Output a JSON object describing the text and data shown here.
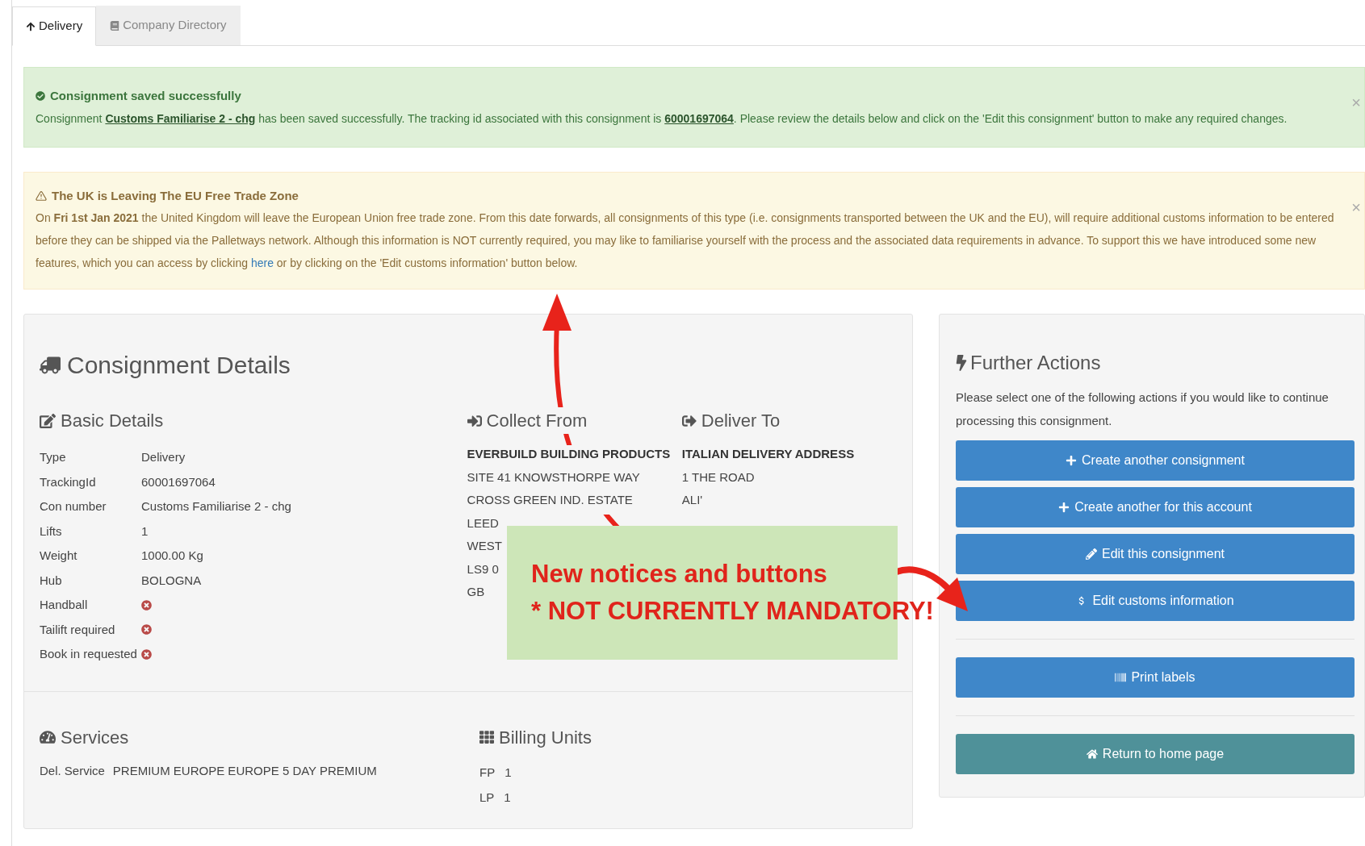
{
  "tabs": [
    {
      "label": "Delivery",
      "selected": true
    },
    {
      "label": "Company Directory",
      "selected": false
    }
  ],
  "success_alert": {
    "title": "Consignment saved successfully",
    "close": "×",
    "parts": [
      {
        "kind": "text",
        "text": "Consignment "
      },
      {
        "kind": "link",
        "text": "Customs Familiarise 2 - chg"
      },
      {
        "kind": "text",
        "text": " has been saved successfully. The tracking id associated with this consignment is "
      },
      {
        "kind": "link",
        "text": "60001697064"
      },
      {
        "kind": "text",
        "text": ". Please review the details below and click on the 'Edit this consignment' button to make any required changes."
      }
    ]
  },
  "warning_alert": {
    "title": "The UK is Leaving The EU Free Trade Zone",
    "close": "×",
    "parts": [
      {
        "kind": "text",
        "text": "On **Fri 1st Jan 2021** the United Kingdom will leave the European Union free trade zone. From this date forwards, all consignments of this type (i.e. consignments transported between the UK and the EU), will require additional customs information to be entered before they can be shipped via the Palletways network. Although this information is NOT currently required, you may like to familiarise yourself with the process and the associated data requirements in advance. To support this we have introduced some new features, which you can access by clicking "
      },
      {
        "kind": "link",
        "text": "here"
      },
      {
        "kind": "text",
        "text": " or by clicking on the 'Edit customs information' button below."
      }
    ]
  },
  "consignment": {
    "title": "Consignment Details",
    "basic_title": "Basic Details",
    "rows": [
      {
        "label": "Type",
        "kind": "text",
        "value": "Delivery"
      },
      {
        "label": "TrackingId",
        "kind": "text",
        "value": "60001697064"
      },
      {
        "label": "Con number",
        "kind": "text",
        "value": "Customs Familiarise 2 - chg"
      },
      {
        "label": "Lifts",
        "kind": "text",
        "value": "1"
      },
      {
        "label": "Weight",
        "kind": "text",
        "value": "1000.00 Kg"
      },
      {
        "label": "Hub",
        "kind": "text",
        "value": "BOLOGNA"
      },
      {
        "label": "Handball",
        "kind": "flag",
        "on": false
      },
      {
        "label": "Tailift required",
        "kind": "flag",
        "on": false
      },
      {
        "label": "Book in requested",
        "kind": "flag",
        "on": false
      }
    ],
    "addresses": [
      {
        "title": "Collect From",
        "name": "EVERBUILD BUILDING PRODUCTS",
        "lines": [
          "SITE 41 KNOWSTHORPE WAY",
          "CROSS GREEN IND. ESTATE",
          "LEED",
          "WEST",
          "LS9 0",
          "GB"
        ]
      },
      {
        "title": "Deliver To",
        "name": "ITALIAN DELIVERY ADDRESS",
        "lines": [
          "1 THE ROAD",
          "ALI'"
        ]
      }
    ],
    "services": {
      "title": "Services",
      "rows": [
        {
          "label": "Del. Service",
          "value": "PREMIUM EUROPE EUROPE 5 DAY PREMIUM"
        }
      ]
    },
    "billing": {
      "title": "Billing Units",
      "rows": [
        {
          "label": "FP",
          "value": "1"
        },
        {
          "label": "LP",
          "value": "1"
        }
      ]
    }
  },
  "actions": {
    "title": "Further Actions",
    "description": "Please select one of the following actions if you would like to continue processing this consignment.",
    "groups": [
      [
        {
          "label": "Create another consignment",
          "kind": "primary"
        },
        {
          "label": "Create another for this account",
          "kind": "primary"
        },
        {
          "label": "Edit this consignment",
          "kind": "primary"
        },
        {
          "label": "Edit customs information",
          "kind": "primary"
        }
      ],
      [
        {
          "label": "Print labels",
          "kind": "primary"
        }
      ],
      [
        {
          "label": "Return to home page",
          "kind": "home"
        }
      ]
    ]
  },
  "annotation": {
    "lines": [
      "New notices and buttons",
      "* NOT CURRENTLY MANDATORY!"
    ]
  }
}
